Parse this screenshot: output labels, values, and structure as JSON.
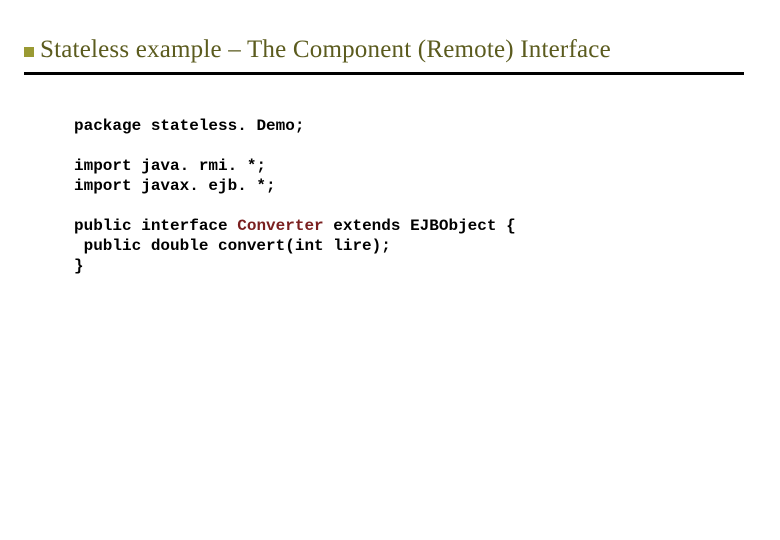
{
  "title": "Stateless example – The Component (Remote) Interface",
  "code": {
    "l1a": "package",
    "l1b": " stateless. Demo;",
    "blank1": "",
    "l2a": "import",
    "l2b": " java. rmi. *;",
    "l3a": "import",
    "l3b": " javax. ejb. *;",
    "blank2": "",
    "l4a": "public interface ",
    "l4b": "Converter",
    "l4c": " extends EJBObject {",
    "l5": " public double convert(int lire);",
    "l6": "}"
  }
}
